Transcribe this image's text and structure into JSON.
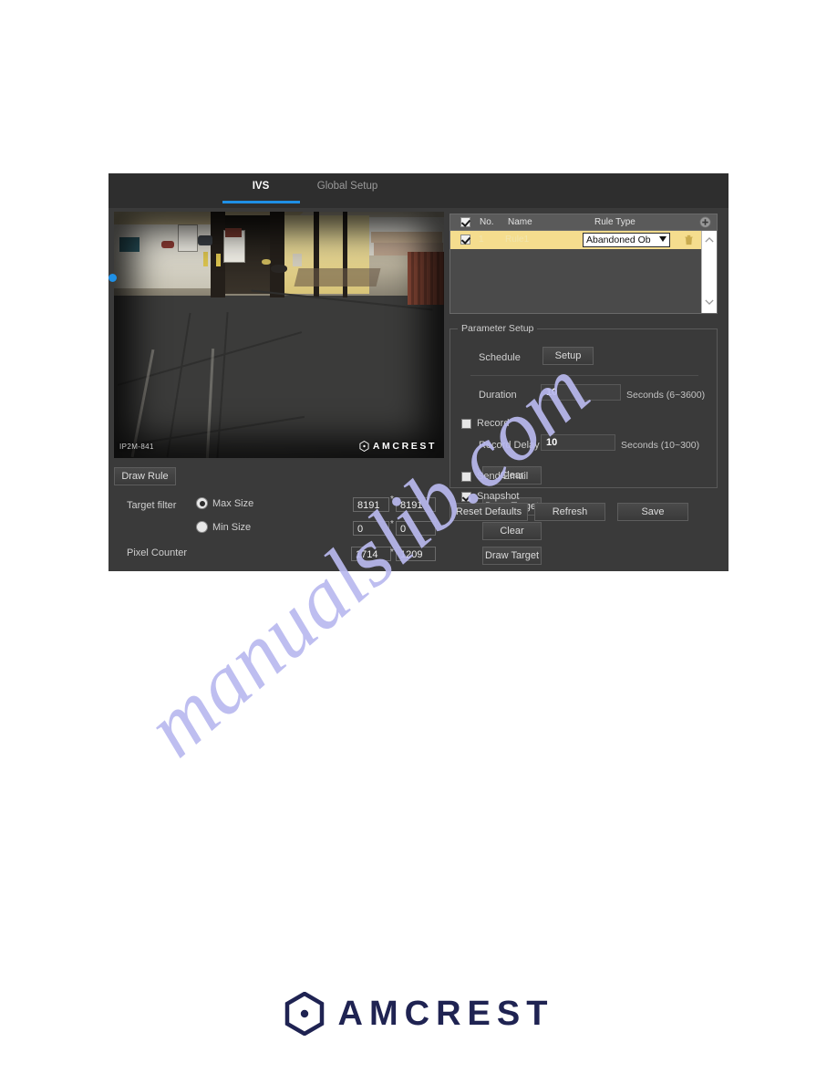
{
  "tabs": {
    "ivs": "IVS",
    "global_setup": "Global Setup"
  },
  "video": {
    "model_label": "IP2M-841",
    "brand": "AMCREST"
  },
  "draw_controls": {
    "draw_rule": "Draw Rule",
    "clear_rule": "Clear",
    "draw_target_max": "Draw Target",
    "clear_min": "Clear",
    "draw_target_pixel": "Draw Target"
  },
  "target_filter": {
    "label": "Target filter",
    "max_size_label": "Max Size",
    "min_size_label": "Min Size",
    "max_width": "8191",
    "max_height": "8191",
    "min_width": "0",
    "min_height": "0",
    "separator": "*",
    "selected": "max"
  },
  "pixel_counter": {
    "label": "Pixel Counter",
    "width": "1714",
    "height": "1209",
    "separator": "*"
  },
  "rule_table": {
    "columns": {
      "no": "No.",
      "name": "Name",
      "rule_type": "Rule Type"
    },
    "header_checked": true,
    "add_icon": "add-circle-icon",
    "rows": [
      {
        "checked": true,
        "no": "1",
        "name": "Rule1",
        "rule_type": "Abandoned Ob",
        "delete_icon": "trash-icon"
      }
    ]
  },
  "parameter_setup": {
    "title": "Parameter Setup",
    "schedule_label": "Schedule",
    "schedule_button": "Setup",
    "duration_label": "Duration",
    "duration_value": "10",
    "duration_hint": "Seconds (6~3600)",
    "record_label": "Record",
    "record_checked": false,
    "record_delay_label": "Record Delay",
    "record_delay_value": "10",
    "record_delay_hint": "Seconds (10~300)",
    "send_email_label": "Send Email",
    "send_email_checked": false,
    "snapshot_label": "Snapshot",
    "snapshot_checked": true
  },
  "actions": {
    "reset_defaults": "Reset Defaults",
    "refresh": "Refresh",
    "save": "Save"
  },
  "watermark": {
    "text": "manualslib.com"
  },
  "footer": {
    "brand": "AMCREST"
  },
  "colors": {
    "accent_blue": "#1f90e6",
    "row_highlight": "#f5dd8e",
    "panel_bg": "#3a3a3a",
    "tabbar_bg": "#2e2e2e",
    "brand_navy": "#1f2352",
    "watermark": "#b9b9ef"
  }
}
